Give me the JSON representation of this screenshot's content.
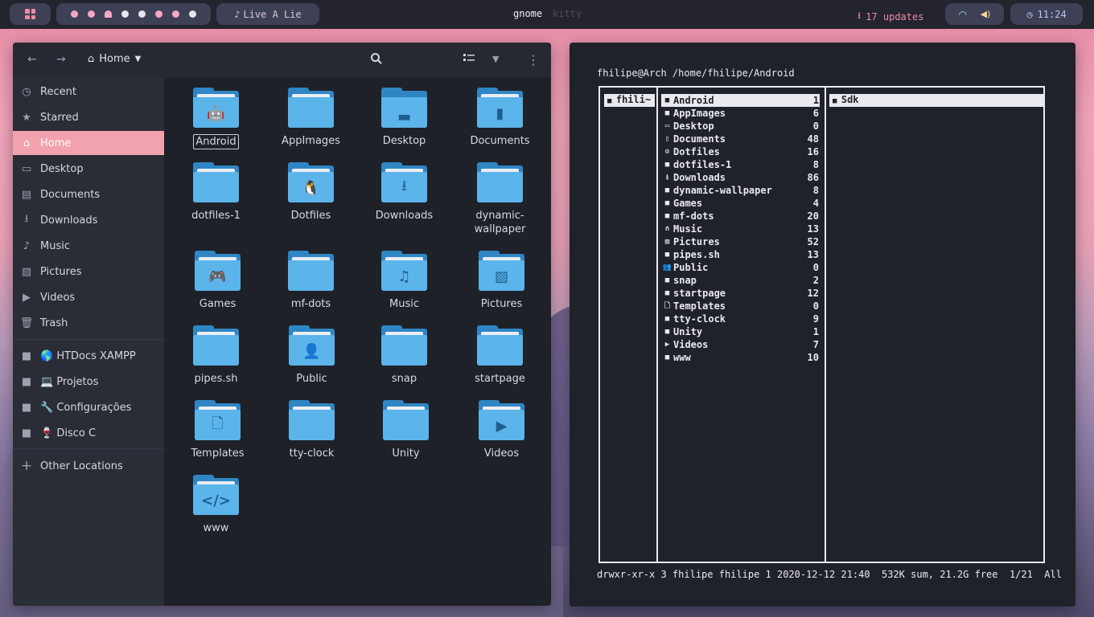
{
  "topbar": {
    "song": "Live A Lie",
    "window_title": "gnome",
    "window_title_inactive": "kitty",
    "updates": "17 updates",
    "clock": "11:24"
  },
  "file_manager": {
    "location": "Home",
    "sidebar": [
      {
        "label": "Recent",
        "icon": "clock-icon"
      },
      {
        "label": "Starred",
        "icon": "star-icon"
      },
      {
        "label": "Home",
        "icon": "home-icon",
        "active": true
      },
      {
        "label": "Desktop",
        "icon": "desktop-icon"
      },
      {
        "label": "Documents",
        "icon": "document-icon"
      },
      {
        "label": "Downloads",
        "icon": "download-icon"
      },
      {
        "label": "Music",
        "icon": "music-icon"
      },
      {
        "label": "Pictures",
        "icon": "picture-icon"
      },
      {
        "label": "Videos",
        "icon": "video-icon"
      },
      {
        "label": "Trash",
        "icon": "trash-icon"
      }
    ],
    "bookmarks": [
      {
        "label": "🌎 HTDocs XAMPP"
      },
      {
        "label": "💻 Projetos"
      },
      {
        "label": "🔧 Configurações"
      },
      {
        "label": "🍷 Disco C"
      }
    ],
    "other_locations": "Other Locations",
    "folders": [
      {
        "label": "Android",
        "emblem": "android"
      },
      {
        "label": "AppImages",
        "emblem": ""
      },
      {
        "label": "Desktop",
        "emblem": "desktop"
      },
      {
        "label": "Documents",
        "emblem": "document"
      },
      {
        "label": "dotfiles-1",
        "emblem": ""
      },
      {
        "label": "Dotfiles",
        "emblem": "linux"
      },
      {
        "label": "Downloads",
        "emblem": "download"
      },
      {
        "label": "dynamic-wallpaper",
        "emblem": ""
      },
      {
        "label": "Games",
        "emblem": "gamepad"
      },
      {
        "label": "mf-dots",
        "emblem": ""
      },
      {
        "label": "Music",
        "emblem": "music"
      },
      {
        "label": "Pictures",
        "emblem": "picture"
      },
      {
        "label": "pipes.sh",
        "emblem": ""
      },
      {
        "label": "Public",
        "emblem": "user"
      },
      {
        "label": "snap",
        "emblem": ""
      },
      {
        "label": "startpage",
        "emblem": ""
      },
      {
        "label": "Templates",
        "emblem": "template"
      },
      {
        "label": "tty-clock",
        "emblem": ""
      },
      {
        "label": "Unity",
        "emblem": ""
      },
      {
        "label": "Videos",
        "emblem": "video"
      },
      {
        "label": "www",
        "emblem": "code"
      }
    ]
  },
  "terminal": {
    "prompt_path": "fhilipe@Arch /home/fhilipe/Android",
    "parent_column": "fhili~",
    "preview_column": "Sdk",
    "entries": [
      {
        "name": "Android",
        "count": "1",
        "icon": "folder"
      },
      {
        "name": "AppImages",
        "count": "6",
        "icon": "folder"
      },
      {
        "name": "Desktop",
        "count": "0",
        "icon": "desktop"
      },
      {
        "name": "Documents",
        "count": "48",
        "icon": "document"
      },
      {
        "name": "Dotfiles",
        "count": "16",
        "icon": "gear"
      },
      {
        "name": "dotfiles-1",
        "count": "8",
        "icon": "folder"
      },
      {
        "name": "Downloads",
        "count": "86",
        "icon": "download"
      },
      {
        "name": "dynamic-wallpaper",
        "count": "8",
        "icon": "folder"
      },
      {
        "name": "Games",
        "count": "4",
        "icon": "folder"
      },
      {
        "name": "mf-dots",
        "count": "20",
        "icon": "folder"
      },
      {
        "name": "Music",
        "count": "13",
        "icon": "headphones"
      },
      {
        "name": "Pictures",
        "count": "52",
        "icon": "picture"
      },
      {
        "name": "pipes.sh",
        "count": "13",
        "icon": "folder"
      },
      {
        "name": "Public",
        "count": "0",
        "icon": "users"
      },
      {
        "name": "snap",
        "count": "2",
        "icon": "folder"
      },
      {
        "name": "startpage",
        "count": "12",
        "icon": "folder"
      },
      {
        "name": "Templates",
        "count": "0",
        "icon": "template"
      },
      {
        "name": "tty-clock",
        "count": "9",
        "icon": "folder"
      },
      {
        "name": "Unity",
        "count": "1",
        "icon": "folder"
      },
      {
        "name": "Videos",
        "count": "7",
        "icon": "video"
      },
      {
        "name": "www",
        "count": "10",
        "icon": "folder"
      }
    ],
    "status_line": "drwxr-xr-x 3 fhilipe fhilipe 1 2020-12-12 21:40  532K sum, 21.2G free  1/21  All"
  }
}
